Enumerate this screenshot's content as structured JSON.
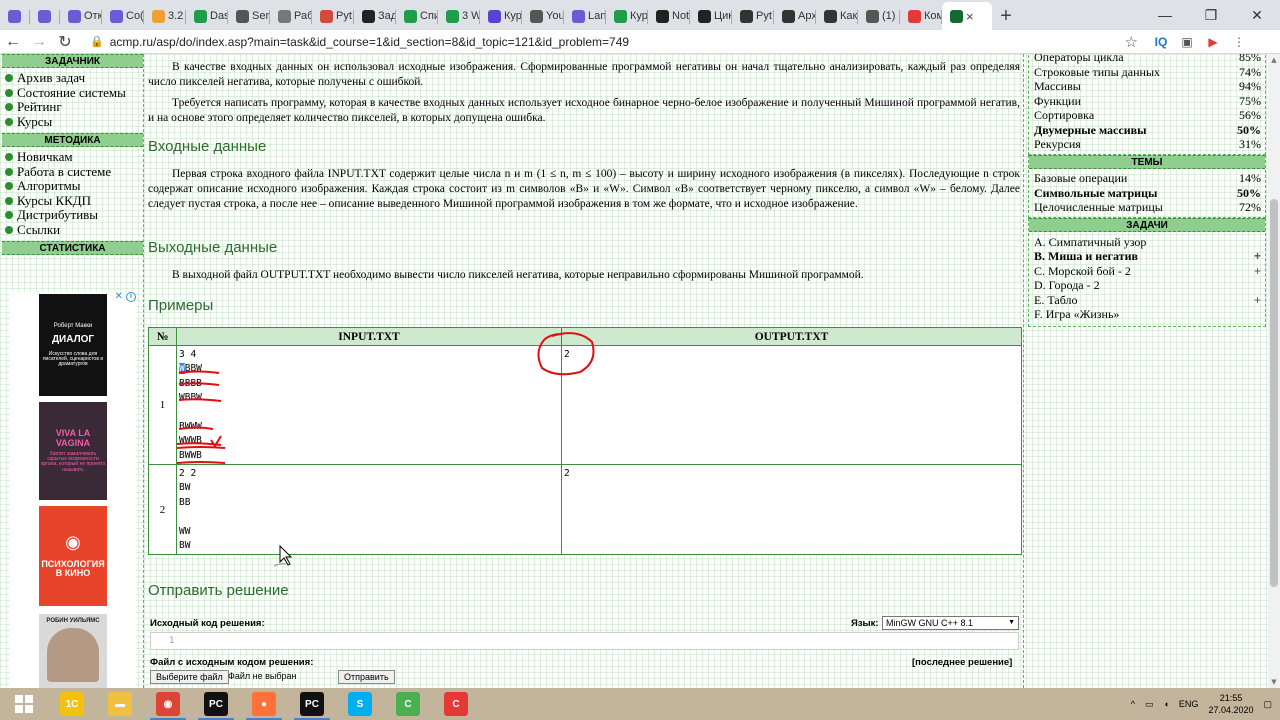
{
  "browser": {
    "tabs": [
      {
        "title": "",
        "color": "#6b5bd6"
      },
      {
        "title": "",
        "color": "#6b5bd6"
      },
      {
        "title": "Отк",
        "color": "#6b5bd6"
      },
      {
        "title": "Со(",
        "color": "#6b5bd6"
      },
      {
        "title": "3.2",
        "color": "#f0a030"
      },
      {
        "title": "Das",
        "color": "#1e9e4a"
      },
      {
        "title": "Ser(",
        "color": "#555555"
      },
      {
        "title": "Раб",
        "color": "#777777"
      },
      {
        "title": "Pyt",
        "color": "#d44a3a"
      },
      {
        "title": "Зад",
        "color": "#222222"
      },
      {
        "title": "Спи",
        "color": "#1e9e4a"
      },
      {
        "title": "3 W",
        "color": "#1e9e4a"
      },
      {
        "title": "Кур",
        "color": "#5b3fd6"
      },
      {
        "title": "You",
        "color": "#555555"
      },
      {
        "title": "Lan",
        "color": "#6b5bd6"
      },
      {
        "title": "Кур",
        "color": "#1e9e4a"
      },
      {
        "title": "Not",
        "color": "#222222"
      },
      {
        "title": "Цик",
        "color": "#222222"
      },
      {
        "title": "Pyt",
        "color": "#333333"
      },
      {
        "title": "Арх",
        "color": "#333333"
      },
      {
        "title": "Как",
        "color": "#333333"
      },
      {
        "title": "(1)",
        "color": "#555555"
      },
      {
        "title": "Ком",
        "color": "#e53935"
      }
    ],
    "active_tab_close": "×",
    "new_tab": "+",
    "window_controls": {
      "minimize": "—",
      "maximize": "❐",
      "close": "✕"
    },
    "nav": {
      "back": "←",
      "forward": "→",
      "reload": "↻"
    },
    "url": "acmp.ru/asp/do/index.asp?main=task&id_course=1&id_section=8&id_topic=121&id_problem=749",
    "lock_icon": "🔒",
    "star_icon": "☆",
    "ext_icons": [
      "IQ",
      "▣",
      "▶",
      "⋮"
    ]
  },
  "left_sidebar": {
    "sections": [
      {
        "title": "ЗАДАЧНИК",
        "items": [
          "Архив задач",
          "Состояние системы",
          "Рейтинг",
          "Курсы"
        ]
      },
      {
        "title": "МЕТОДИКА",
        "items": [
          "Новичкам",
          "Работа в системе",
          "Алгоритмы",
          "Курсы ККДП",
          "Дистрибутивы",
          "Ссылки"
        ]
      },
      {
        "title": "СТАТИСТИКА",
        "items": []
      }
    ],
    "ad_info": "i",
    "ad_close": "✕",
    "books": [
      {
        "author": "Роберт Макки",
        "title": "ДИАЛОГ",
        "subtitle": "Искусство слова для писателей, сценаристов и драматургов",
        "bg": "#111111",
        "fg": "#ffffff"
      },
      {
        "author": "",
        "title": "VIVA LA VAGINA",
        "subtitle": "Хватит замалчивать скрытые возможности органа, который не принято называть",
        "bg": "#3a2a36",
        "fg": "#f25ab0"
      },
      {
        "author": "",
        "title": "ПСИХОЛОГИЯ В КИНО",
        "subtitle": "",
        "bg": "#e8442c",
        "fg": "#ffffff"
      },
      {
        "author": "РОБИН УИЛЬЯМС",
        "title": "",
        "subtitle": "",
        "bg": "#d9d9d9",
        "fg": "#222222"
      }
    ]
  },
  "problem": {
    "intro": "В качестве входных данных он использовал исходные изображения. Сформированные программой негативы он начал тщательно анализировать, каждый раз определяя число пикселей негатива, которые получены с ошибкой.",
    "task": "Требуется написать программу, которая в качестве входных данных использует исходное бинарное черно-белое изображение и полученный Мишиной программой негатив, и на основе этого определяет количество пикселей, в которых допущена ошибка.",
    "input_title": "Входные данные",
    "input_text": "Первая строка входного файла INPUT.TXT содержит целые числа n и m (1 ≤ n, m ≤ 100) – высоту и ширину исходного изображения (в пикселях). Последующие n строк содержат описание исходного изображения. Каждая строка состоит из m символов «B» и «W». Символ «B» соответствует черному пикселю, а символ «W» – белому. Далее следует пустая строка, а после нее – описание выведенного Мишиной программой изображения в том же формате, что и исходное изображение.",
    "output_title": "Выходные данные",
    "output_text": "В выходной файл OUTPUT.TXT необходимо вывести число пикселей негатива, которые неправильно сформированы Мишиной программой.",
    "examples_title": "Примеры",
    "table_headers": [
      "№",
      "INPUT.TXT",
      "OUTPUT.TXT"
    ],
    "examples": [
      {
        "n": "1",
        "input_first": "3 4",
        "input_highlight": "W",
        "input_rest": "BBW\nBBBB\nWBBW\n\nBWWW\nWWWB\nBWWB",
        "output": "2"
      },
      {
        "n": "2",
        "input_first": "2 2",
        "input_highlight": "",
        "input_rest": "BW\nBB\n\nWW\nBW",
        "output": "2"
      }
    ]
  },
  "submit": {
    "title": "Отправить решение",
    "source_label": "Исходный код решения:",
    "lang_label": "Язык:",
    "lang_value": "MinGW GNU C++ 8.1",
    "lang_arrow": "▼",
    "line_number": "1",
    "file_label": "Файл с исходным кодом решения:",
    "last_solution": "[последнее решение]",
    "choose_file": "Выберите файл",
    "no_file": "Файл не выбран",
    "send": "Отправить"
  },
  "right_sidebar": {
    "stats": [
      {
        "name": "Операторы цикла",
        "pct": "85%",
        "bold": false
      },
      {
        "name": "Строковые типы данных",
        "pct": "74%",
        "bold": false
      },
      {
        "name": "Массивы",
        "pct": "94%",
        "bold": false
      },
      {
        "name": "Функции",
        "pct": "75%",
        "bold": false
      },
      {
        "name": "Сортировка",
        "pct": "56%",
        "bold": false
      },
      {
        "name": "Двумерные массивы",
        "pct": "50%",
        "bold": true
      },
      {
        "name": "Рекурсия",
        "pct": "31%",
        "bold": false
      }
    ],
    "themes_title": "ТЕМЫ",
    "themes": [
      {
        "name": "Базовые операции",
        "pct": "14%",
        "bold": false
      },
      {
        "name": "Символьные матрицы",
        "pct": "50%",
        "bold": true
      },
      {
        "name": "Целочисленные матрицы",
        "pct": "72%",
        "bold": false
      }
    ],
    "tasks_title": "ЗАДАЧИ",
    "tasks": [
      {
        "name": "A. Симпатичный узор",
        "mark": "",
        "current": false
      },
      {
        "name": "B. Миша и негатив",
        "mark": "+",
        "current": true
      },
      {
        "name": "C. Морской бой - 2",
        "mark": "+",
        "current": false
      },
      {
        "name": "D. Города - 2",
        "mark": "",
        "current": false
      },
      {
        "name": "E. Табло",
        "mark": "+",
        "current": false
      },
      {
        "name": "F. Игра «Жизнь»",
        "mark": "",
        "current": false
      }
    ]
  },
  "taskbar": {
    "start_icon": "windows-logo",
    "apps": [
      {
        "label": "1С",
        "color": "#f4c20d",
        "running": false
      },
      {
        "label": "▬",
        "color": "#f0c040",
        "running": false
      },
      {
        "label": "◉",
        "color": "#db4437",
        "running": true
      },
      {
        "label": "PC",
        "color": "#111111",
        "running": true
      },
      {
        "label": "●",
        "color": "#ff7139",
        "running": true
      },
      {
        "label": "PC",
        "color": "#111111",
        "running": true
      },
      {
        "label": "S",
        "color": "#00aff0",
        "running": false
      },
      {
        "label": "C",
        "color": "#4caf50",
        "running": false
      },
      {
        "label": "C",
        "color": "#e53935",
        "running": false
      }
    ],
    "tray_arrow": "^",
    "lang": "ENG",
    "time": "21:55",
    "date": "27.04.2020"
  }
}
